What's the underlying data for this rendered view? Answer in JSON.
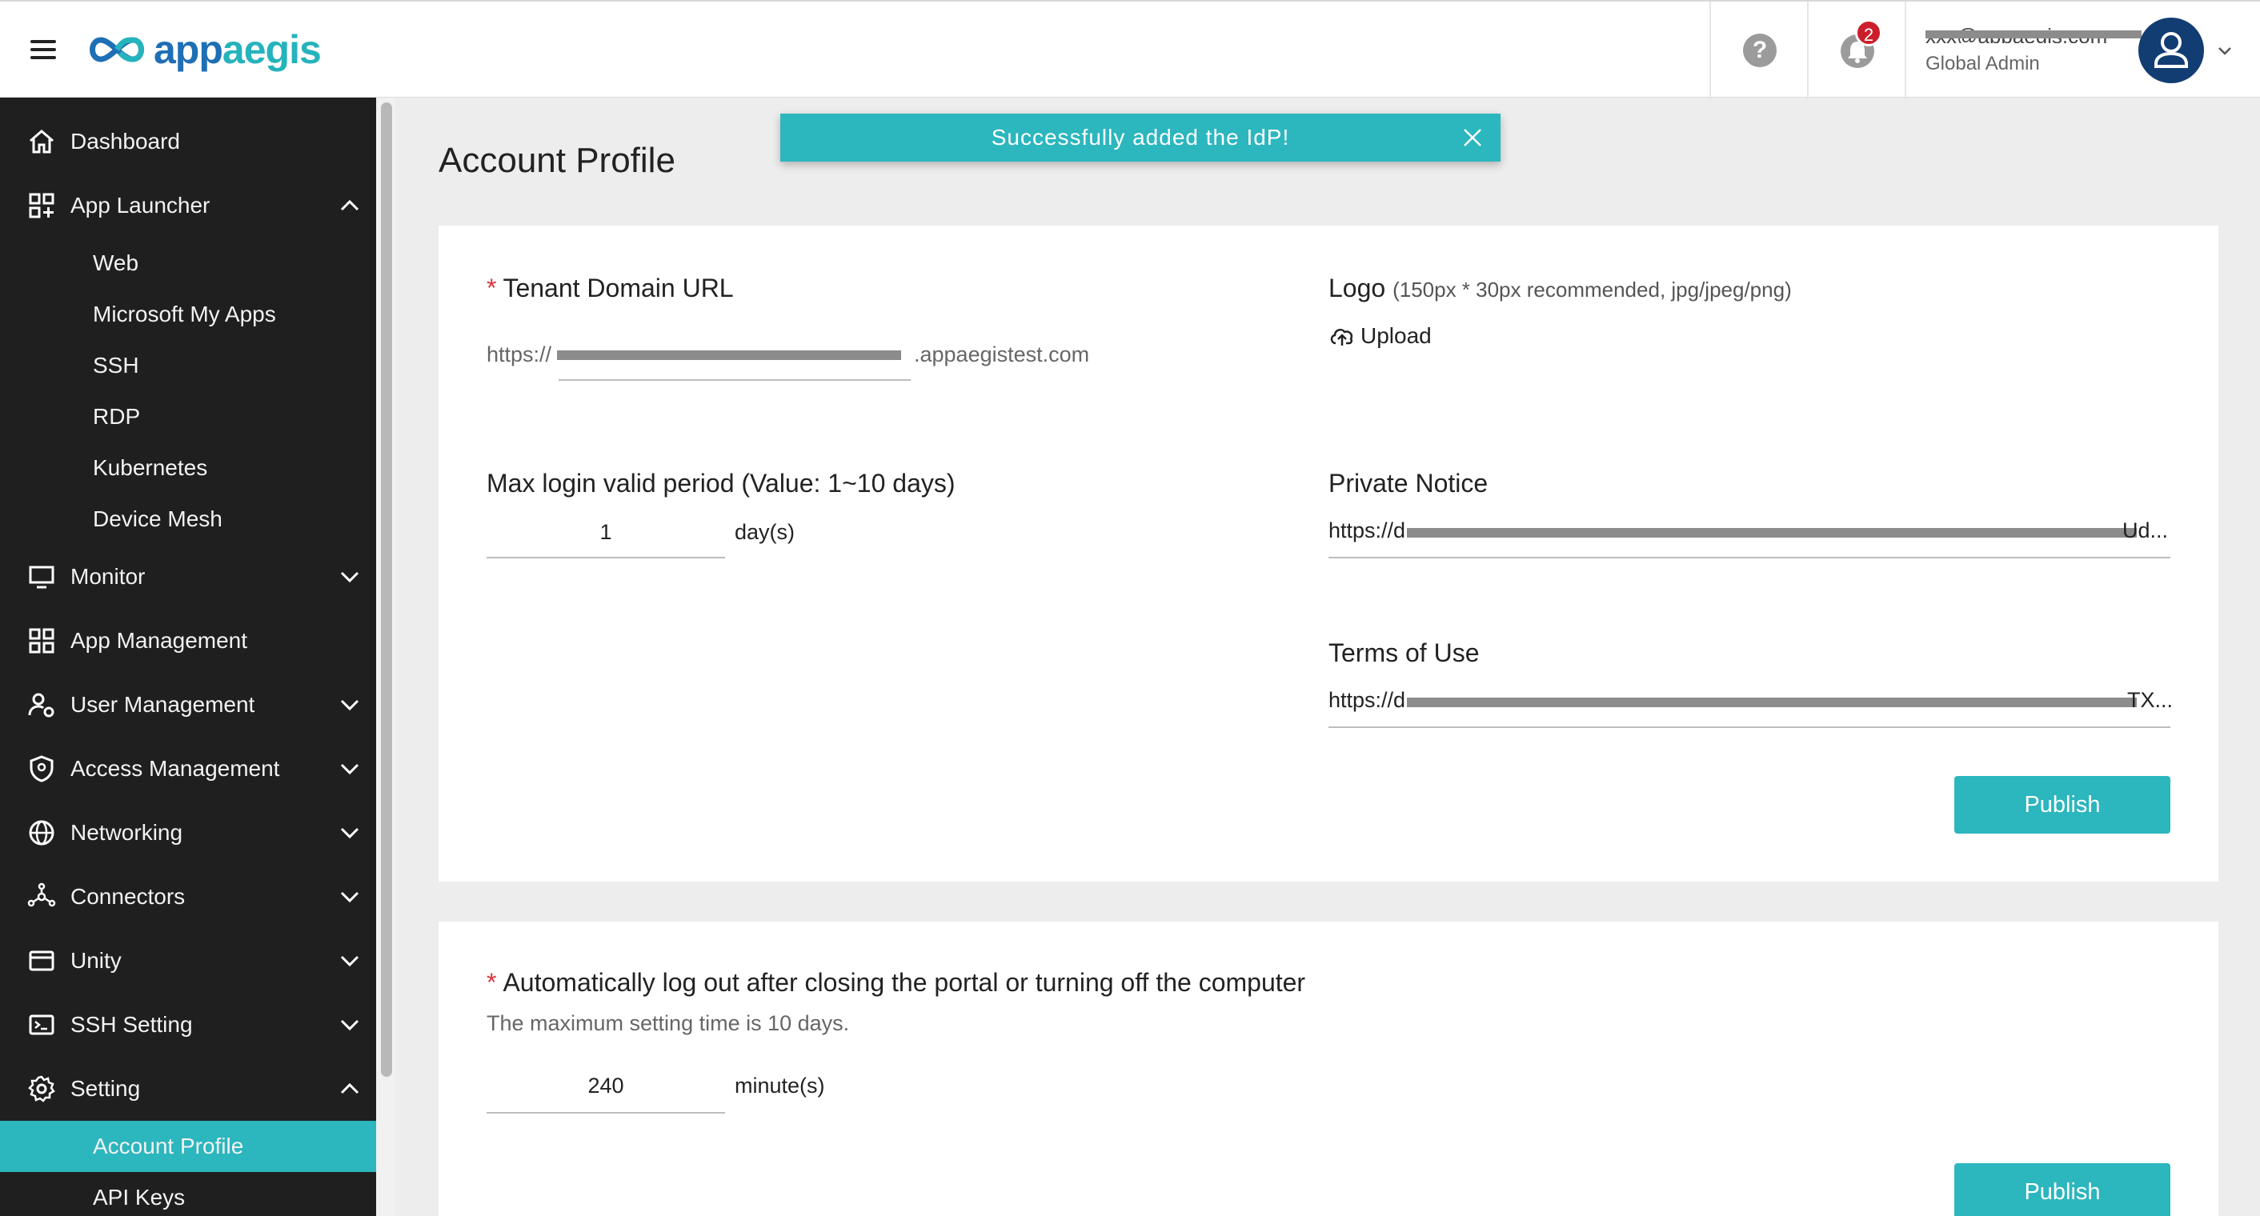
{
  "header": {
    "logo_text_a": "app",
    "logo_text_b": "aegis",
    "notification_count": "2",
    "user_email": "xxx@appaegis.com",
    "user_role": "Global Admin",
    "help_glyph": "?"
  },
  "sidebar": {
    "items": [
      {
        "label": "Dashboard",
        "icon": "home-icon"
      },
      {
        "label": "App Launcher",
        "icon": "apps-plus-icon"
      },
      {
        "label": "Monitor",
        "icon": "monitor-icon"
      },
      {
        "label": "App Management",
        "icon": "grid-icon"
      },
      {
        "label": "User Management",
        "icon": "user-gear-icon"
      },
      {
        "label": "Access Management",
        "icon": "shield-icon"
      },
      {
        "label": "Networking",
        "icon": "globe-icon"
      },
      {
        "label": "Connectors",
        "icon": "hub-icon"
      },
      {
        "label": "Unity",
        "icon": "card-icon"
      },
      {
        "label": "SSH Setting",
        "icon": "terminal-icon"
      },
      {
        "label": "Setting",
        "icon": "gear-icon"
      }
    ],
    "app_launcher_sub": [
      "Web",
      "Microsoft My Apps",
      "SSH",
      "RDP",
      "Kubernetes",
      "Device Mesh"
    ],
    "setting_sub": [
      "Account Profile",
      "API Keys"
    ]
  },
  "toast": {
    "message": "Successfully added the IdP!"
  },
  "main": {
    "title": "Account Profile",
    "tenant": {
      "label": "Tenant Domain URL",
      "prefix": "https://",
      "suffix": ".appaegistest.com"
    },
    "logo": {
      "label": "Logo",
      "hint": "(150px * 30px recommended, jpg/jpeg/png)",
      "upload_label": "Upload"
    },
    "max_login": {
      "label": "Max login valid period (Value: 1~10 days)",
      "value": "1",
      "unit": "day(s)"
    },
    "private_notice": {
      "label": "Private Notice",
      "prefix": "https://d",
      "tail": "Ud..."
    },
    "terms": {
      "label": "Terms of Use",
      "prefix": "https://d",
      "tail": "TX..."
    },
    "publish_label": "Publish",
    "auto_logout": {
      "label": "Automatically log out after closing the portal or turning off the computer",
      "hint": "The maximum setting time is 10 days.",
      "value": "240",
      "unit": "minute(s)"
    }
  }
}
